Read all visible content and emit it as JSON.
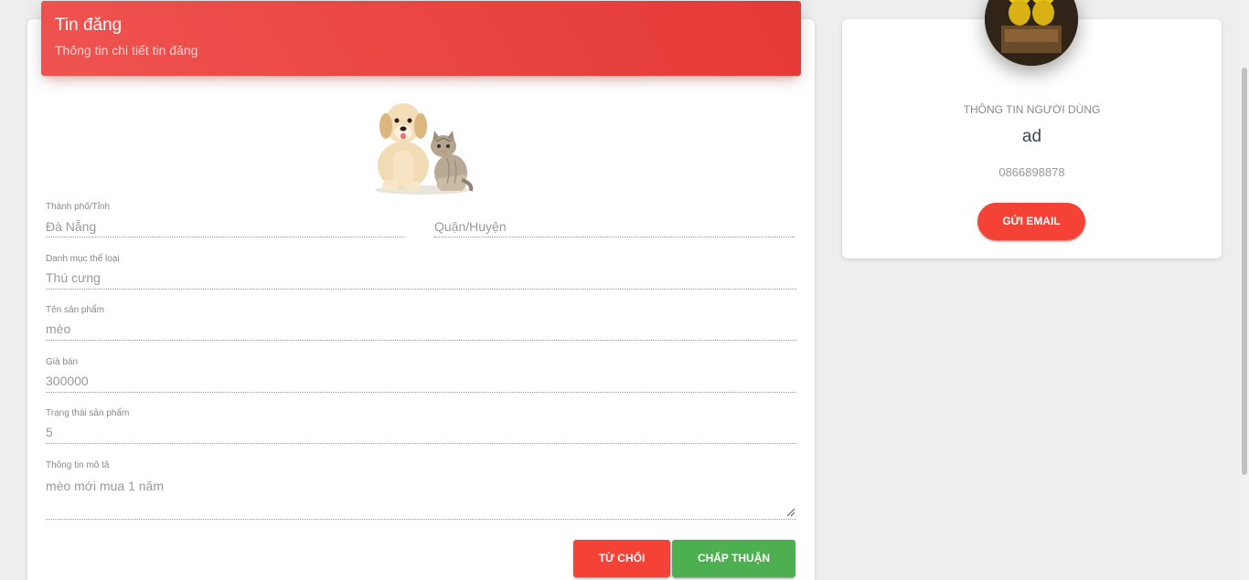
{
  "header": {
    "title": "Tin đăng",
    "subtitle": "Thông tin chi tiết tin đăng"
  },
  "form": {
    "city_label": "Thành phố/Tỉnh",
    "city_value": "Đà Nẵng",
    "district_placeholder": "Quận/Huyện",
    "category_label": "Danh mục thể loại",
    "category_value": "Thú cưng",
    "product_name_label": "Tên sản phẩm",
    "product_name_value": "mèo",
    "price_label": "Giá bán",
    "price_value": "300000",
    "status_label": "Trạng thái sản phẩm",
    "status_value": "5",
    "description_label": "Thông tin mô tả",
    "description_value": "mèo mới mua 1 năm"
  },
  "actions": {
    "reject_label": "TỪ CHỐI",
    "accept_label": "CHẤP THUẬN"
  },
  "user": {
    "section_label": "THÔNG TIN NGƯỜI DÙNG",
    "name": "ad",
    "phone": "0866898878",
    "email_button": "GỬI EMAIL"
  },
  "colors": {
    "header": "#e53935",
    "reject": "#f44336",
    "accept": "#4caf50"
  },
  "icons": {
    "product_image": "dog-and-cat-image",
    "avatar": "user-avatar"
  }
}
